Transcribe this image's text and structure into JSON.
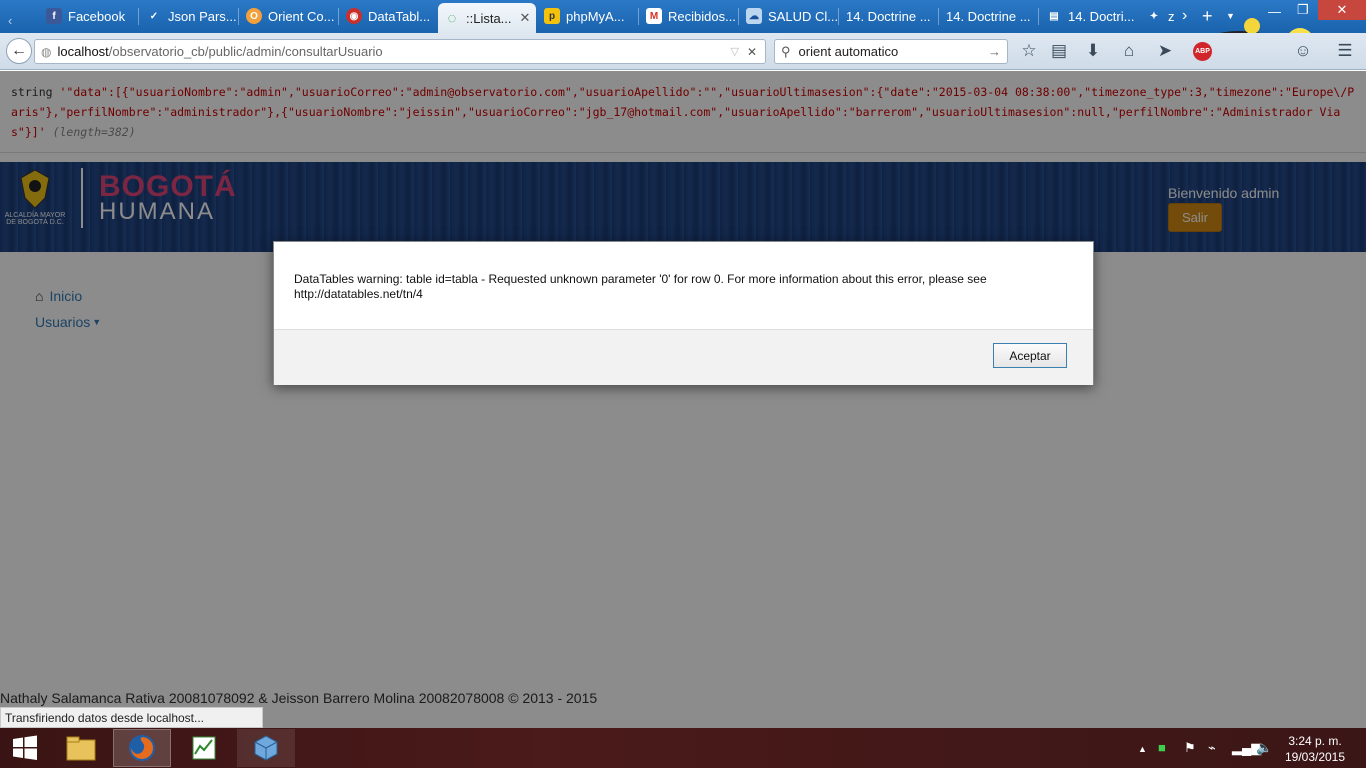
{
  "browser": {
    "tabs": [
      {
        "label": "Facebook",
        "icon": "facebook-icon"
      },
      {
        "label": "Json Pars...",
        "icon": "json-icon"
      },
      {
        "label": "Orient Co...",
        "icon": "orient-icon"
      },
      {
        "label": "DataTabl...",
        "icon": "datatables-icon"
      },
      {
        "label": "::Lista...",
        "icon": "loading-icon"
      },
      {
        "label": "phpMyA...",
        "icon": "phpmyadmin-icon"
      },
      {
        "label": "Recibidos...",
        "icon": "gmail-icon"
      },
      {
        "label": "SALUD Cl...",
        "icon": "cloud-icon"
      },
      {
        "label": "14. Doctrine ...",
        "icon": ""
      },
      {
        "label": "14. Doctrine ...",
        "icon": ""
      },
      {
        "label": "14. Doctri...",
        "icon": "book-icon"
      },
      {
        "label": "z",
        "icon": ""
      }
    ],
    "url_host": "localhost",
    "url_path": "/observatorio_cb/public/admin/consultarUsuario",
    "search_value": "orient automatico",
    "abp_label": "ABP"
  },
  "dump": {
    "type_label": "string",
    "value": "'\"data\":[{\"usuarioNombre\":\"admin\",\"usuarioCorreo\":\"admin@observatorio.com\",\"usuarioApellido\":\"\",\"usuarioUltimasesion\":{\"date\":\"2015-03-04 08:38:00\",\"timezone_type\":3,\"timezone\":\"Europe\\/Paris\"},\"perfilNombre\":\"administrador\"},{\"usuarioNombre\":\"jeissin\",\"usuarioCorreo\":\"jgb_17@hotmail.com\",\"usuarioApellido\":\"barrerom\",\"usuarioUltimasesion\":null,\"perfilNombre\":\"Administrador Vias\"}]'",
    "length": "(length=382)"
  },
  "header": {
    "logo_text_1": "ALCALDÍA MAYOR",
    "logo_text_2": "DE BOGOTÁ D.C.",
    "brand_top": "BOGOTÁ",
    "brand_bottom": "HUMANA",
    "greeting": "Bienvenido admin",
    "logout_label": "Salir"
  },
  "sidenav": {
    "home_label": "Inicio",
    "users_label": "Usuarios"
  },
  "footer": {
    "text": "Nathaly Salamanca Rativa 20081078092 & Jeisson Barrero Molina 20082078008 © 2013 - 2015"
  },
  "status": {
    "text": "Transfiriendo datos desde localhost..."
  },
  "dialog": {
    "message": "DataTables warning: table id=tabla - Requested unknown parameter '0' for row 0. For more information about this error, please see http://datatables.net/tn/4",
    "ok_label": "Aceptar"
  },
  "taskbar": {
    "time": "3:24 p. m.",
    "date": "19/03/2015"
  },
  "colors": {
    "header_blue": "#1d3f7a",
    "logout_button": "#d28a15",
    "link_blue": "#337ab7",
    "string_red": "#cc0000"
  }
}
